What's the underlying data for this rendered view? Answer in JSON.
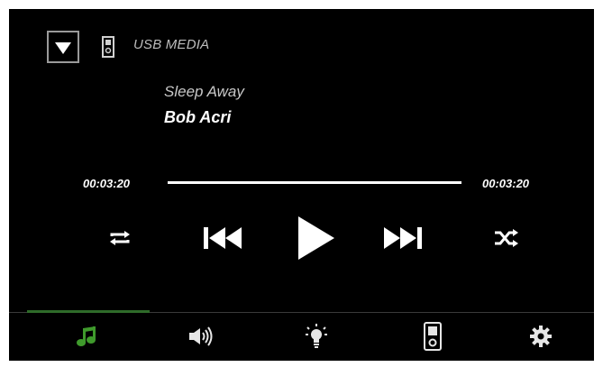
{
  "source": {
    "label": "USB MEDIA",
    "dropdown_icon": "triangle-down-icon",
    "device_icon": "usb-device-icon"
  },
  "track": {
    "title": "Sleep Away",
    "artist": "Bob Acri"
  },
  "progress": {
    "elapsed": "00:03:20",
    "total": "00:03:20",
    "fraction": 1.0
  },
  "controls": [
    {
      "name": "repeat",
      "icon": "repeat-icon"
    },
    {
      "name": "previous",
      "icon": "skip-previous-icon"
    },
    {
      "name": "play",
      "icon": "play-icon"
    },
    {
      "name": "next",
      "icon": "skip-next-icon"
    },
    {
      "name": "shuffle",
      "icon": "shuffle-icon"
    }
  ],
  "tabs": [
    {
      "name": "music",
      "icon": "music-note-icon",
      "active": true
    },
    {
      "name": "sound",
      "icon": "speaker-icon",
      "active": false
    },
    {
      "name": "lighting",
      "icon": "lightbulb-icon",
      "active": false
    },
    {
      "name": "device",
      "icon": "media-player-icon",
      "active": false
    },
    {
      "name": "settings",
      "icon": "gear-icon",
      "active": false
    }
  ],
  "colors": {
    "background": "#000000",
    "text_primary": "#ffffff",
    "text_secondary": "#bdbdbd",
    "accent_active": "#3f9a2c",
    "icon_inactive": "#e6e6e6"
  }
}
